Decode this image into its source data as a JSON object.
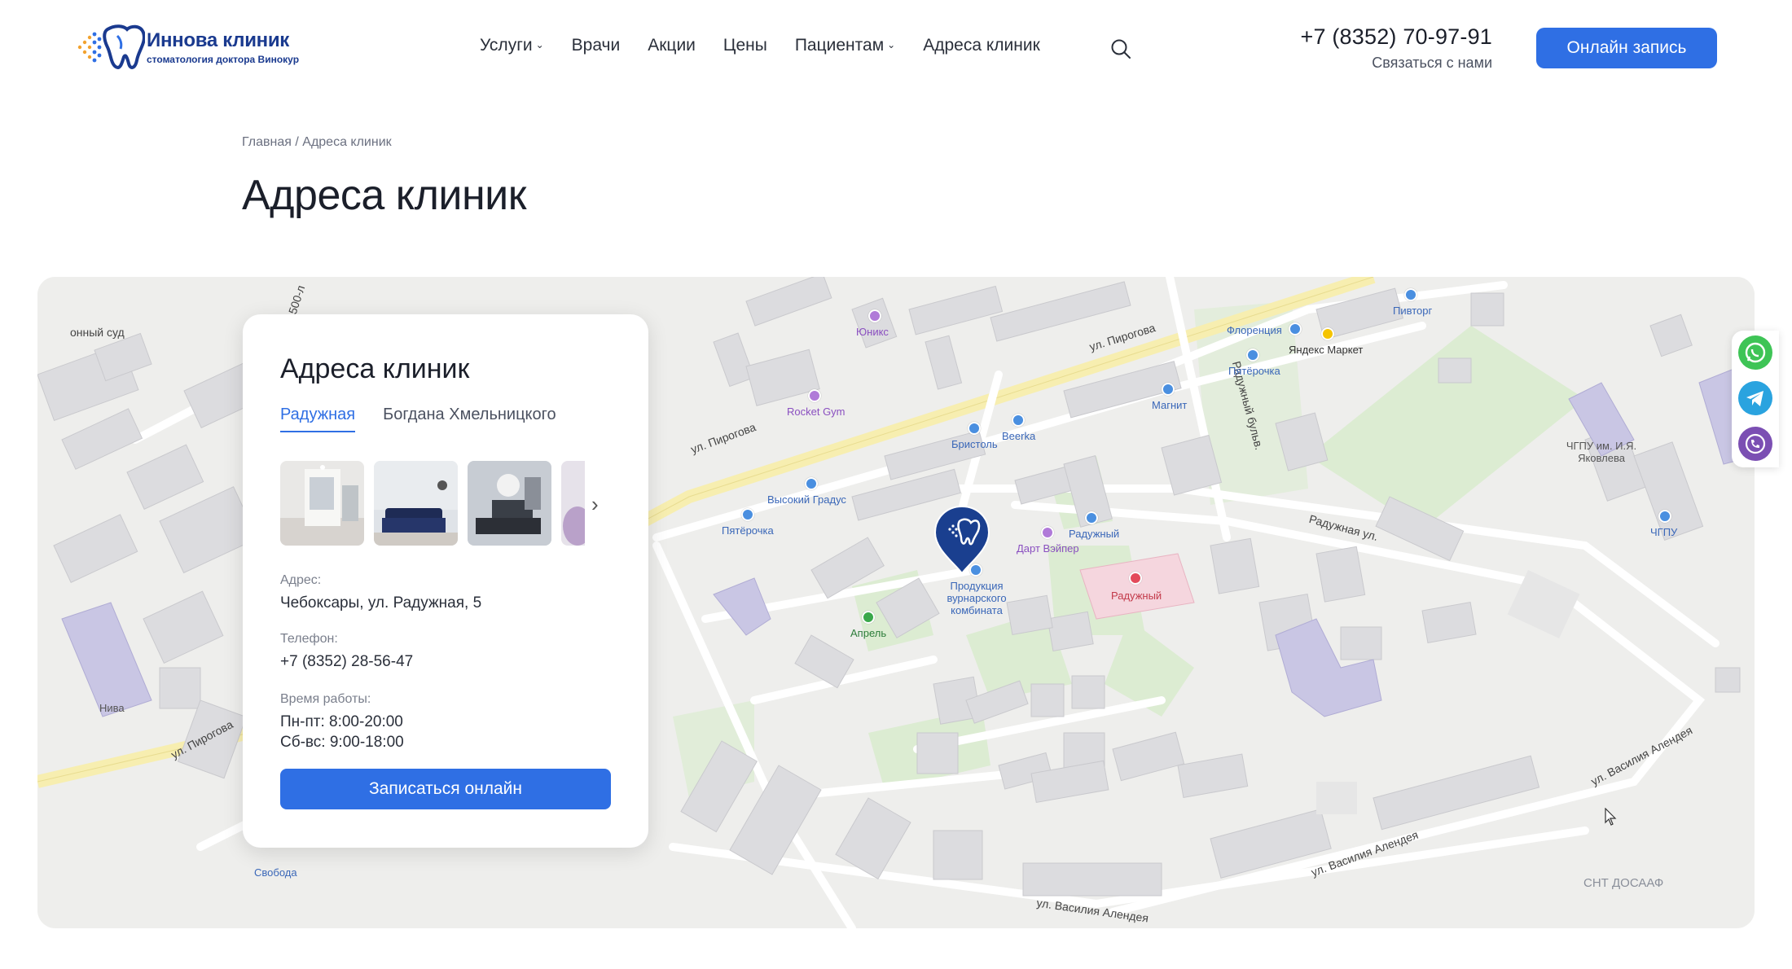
{
  "header": {
    "logo": {
      "name": "Иннова клиник",
      "subtitle": "стоматология доктора Винокур"
    },
    "nav": [
      {
        "label": "Услуги",
        "dropdown": true
      },
      {
        "label": "Врачи",
        "dropdown": false
      },
      {
        "label": "Акции",
        "dropdown": false
      },
      {
        "label": "Цены",
        "dropdown": false
      },
      {
        "label": "Пациентам",
        "dropdown": true
      },
      {
        "label": "Адреса клиник",
        "dropdown": false
      }
    ],
    "search_icon": "search-icon",
    "phone": "+7 (8352) 70-97-91",
    "contact_label": "Связаться с нами",
    "cta_label": "Онлайн запись"
  },
  "breadcrumb": {
    "home": "Главная",
    "separator": "/",
    "current": "Адреса клиник"
  },
  "page_title": "Адреса клиник",
  "card": {
    "title": "Адреса клиник",
    "tabs": [
      "Радужная",
      "Богдана Хмельницкого"
    ],
    "active_tab": 0,
    "address_label": "Адрес:",
    "address": "Чебоксары, ул. Радужная, 5",
    "phone_label": "Телефон:",
    "phone": "+7 (8352) 28-56-47",
    "hours_label": "Время работы:",
    "hours_weekdays": "Пн-пт: 8:00-20:00",
    "hours_weekend": "Сб-вс: 9:00-18:00",
    "book_label": "Записаться онлайн"
  },
  "map": {
    "labels": {
      "pirogova_1": "ул. Пирогова",
      "pirogova_2": "ул. Пирогова",
      "pirogova_3": "ул. Пирогова",
      "raduzhnaya_st": "Радужная ул.",
      "raduzhny_blvd": "Радужный бульв.",
      "alendeya_1": "ул. Василия Алендея",
      "alendeya_2": "ул. Василия Алендея",
      "alendeya_3": "ул. Василия Алендея",
      "sud": "онный суд",
      "yuniks": "Юникс",
      "rocket_gym": "Rocket Gym",
      "bristol": "Бристоль",
      "beerka": "Beerka",
      "magnit": "Магнит",
      "vysoky_gradus": "Высокий Градус",
      "pyaterochka_1": "Пятёрочка",
      "pyaterochka_2": "Пятёрочка",
      "florentsiya": "Флоренция",
      "yandex_market": "Яндекс Маркет",
      "pivtorg": "Пивторг",
      "dart_vayper": "Дарт Вэйпер",
      "raduzhny_shop": "Радужный",
      "raduzhny_med": "Радужный",
      "produktsiya": "Продукция вурнарского комбината",
      "aprel": "Апрель",
      "chgpu_yakovleva": "ЧГПУ им. И.Я. Яковлева",
      "chgpu": "ЧГПУ",
      "niva": "Нива",
      "svoboda": "Свобода",
      "snt_dosaaf": "СНТ ДОСААФ",
      "road_500": "500-л"
    },
    "pin_icon": "clinic-pin-icon"
  },
  "messengers": [
    "whatsapp-icon",
    "telegram-icon",
    "viber-icon"
  ],
  "colors": {
    "accent": "#2f6fe4",
    "brand": "#1a3a8f",
    "pin": "#1a3f8f"
  }
}
